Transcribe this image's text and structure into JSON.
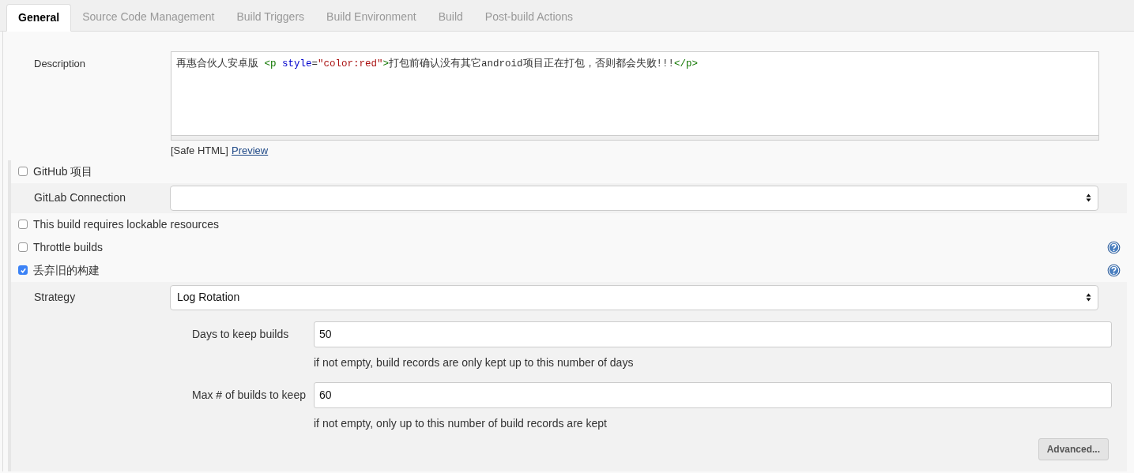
{
  "tabs": [
    {
      "label": "General",
      "selected": true
    },
    {
      "label": "Source Code Management",
      "selected": false
    },
    {
      "label": "Build Triggers",
      "selected": false
    },
    {
      "label": "Build Environment",
      "selected": false
    },
    {
      "label": "Build",
      "selected": false
    },
    {
      "label": "Post-build Actions",
      "selected": false
    }
  ],
  "description": {
    "label": "Description",
    "tokens": [
      {
        "kind": "text",
        "text": "再惠合伙人安卓版 "
      },
      {
        "kind": "tag",
        "text": "<p"
      },
      {
        "kind": "attr",
        "text": " style"
      },
      {
        "kind": "text",
        "text": "="
      },
      {
        "kind": "string",
        "text": "\"color:red\""
      },
      {
        "kind": "tag",
        "text": ">"
      },
      {
        "kind": "text",
        "text": "打包前确认没有其它android项目正在打包，否则都会失败!!!"
      },
      {
        "kind": "tag",
        "text": "</p>"
      }
    ],
    "note": "[Safe HTML]",
    "preview_link": "Preview"
  },
  "rows": [
    {
      "kind": "checkbox",
      "label": "GitHub 项目",
      "checked": false,
      "help": false
    },
    {
      "kind": "select",
      "label": "GitLab Connection"
    },
    {
      "kind": "checkbox",
      "label": "This build requires lockable resources",
      "checked": false,
      "help": false
    },
    {
      "kind": "checkbox",
      "label": "Throttle builds",
      "checked": false,
      "help": true
    },
    {
      "kind": "checkbox",
      "label": "丢弃旧的构建",
      "checked": true,
      "help": true,
      "details": {
        "strategy": {
          "label": "Strategy",
          "value": "Log Rotation"
        },
        "fields": [
          {
            "label": "Days to keep builds",
            "value": "50",
            "hint": "if not empty, build records are only kept up to this number of days"
          },
          {
            "label": "Max # of builds to keep",
            "value": "60",
            "hint": "if not empty, only up to this number of build records are kept"
          }
        ],
        "advanced_button": "Advanced..."
      }
    }
  ]
}
